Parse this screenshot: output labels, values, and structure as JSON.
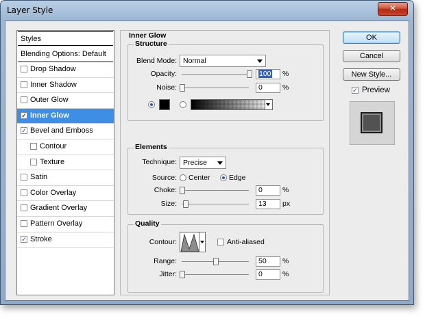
{
  "window": {
    "title": "Layer Style",
    "close_glyph": "✕"
  },
  "sidebar": {
    "header": "Styles",
    "blending": "Blending Options: Default",
    "items": [
      {
        "label": "Drop Shadow",
        "checked": false,
        "selected": false,
        "sub": false
      },
      {
        "label": "Inner Shadow",
        "checked": false,
        "selected": false,
        "sub": false
      },
      {
        "label": "Outer Glow",
        "checked": false,
        "selected": false,
        "sub": false
      },
      {
        "label": "Inner Glow",
        "checked": true,
        "selected": true,
        "sub": false
      },
      {
        "label": "Bevel and Emboss",
        "checked": true,
        "selected": false,
        "sub": false
      },
      {
        "label": "Contour",
        "checked": false,
        "selected": false,
        "sub": true
      },
      {
        "label": "Texture",
        "checked": false,
        "selected": false,
        "sub": true
      },
      {
        "label": "Satin",
        "checked": false,
        "selected": false,
        "sub": false
      },
      {
        "label": "Color Overlay",
        "checked": false,
        "selected": false,
        "sub": false
      },
      {
        "label": "Gradient Overlay",
        "checked": false,
        "selected": false,
        "sub": false
      },
      {
        "label": "Pattern Overlay",
        "checked": false,
        "selected": false,
        "sub": false
      },
      {
        "label": "Stroke",
        "checked": true,
        "selected": false,
        "sub": false
      }
    ]
  },
  "panel": {
    "title": "Inner Glow",
    "structure": {
      "title": "Structure",
      "blend_mode_label": "Blend Mode:",
      "blend_mode_value": "Normal",
      "opacity_label": "Opacity:",
      "opacity_value": "100",
      "opacity_fraction": 1.0,
      "noise_label": "Noise:",
      "noise_value": "0",
      "noise_fraction": 0.0,
      "percent": "%",
      "color_swatch": "#000000",
      "gradient_from": "#000000",
      "gradient_to": "#ffffff"
    },
    "elements": {
      "title": "Elements",
      "technique_label": "Technique:",
      "technique_value": "Precise",
      "source_label": "Source:",
      "center_label": "Center",
      "edge_label": "Edge",
      "choke_label": "Choke:",
      "choke_value": "0",
      "choke_fraction": 0.0,
      "size_label": "Size:",
      "size_value": "13",
      "size_fraction": 0.05,
      "percent": "%",
      "px": "px"
    },
    "quality": {
      "title": "Quality",
      "contour_label": "Contour:",
      "anti_aliased_label": "Anti-aliased",
      "range_label": "Range:",
      "range_value": "50",
      "range_fraction": 0.5,
      "jitter_label": "Jitter:",
      "jitter_value": "0",
      "jitter_fraction": 0.0,
      "percent": "%"
    }
  },
  "buttons": {
    "ok": "OK",
    "cancel": "Cancel",
    "new_style": "New Style...",
    "preview_label": "Preview",
    "preview_checked": true
  },
  "colors": {
    "accent": "#3f8ee6",
    "title_bar": "#9db7d3",
    "close": "#c8442c"
  }
}
